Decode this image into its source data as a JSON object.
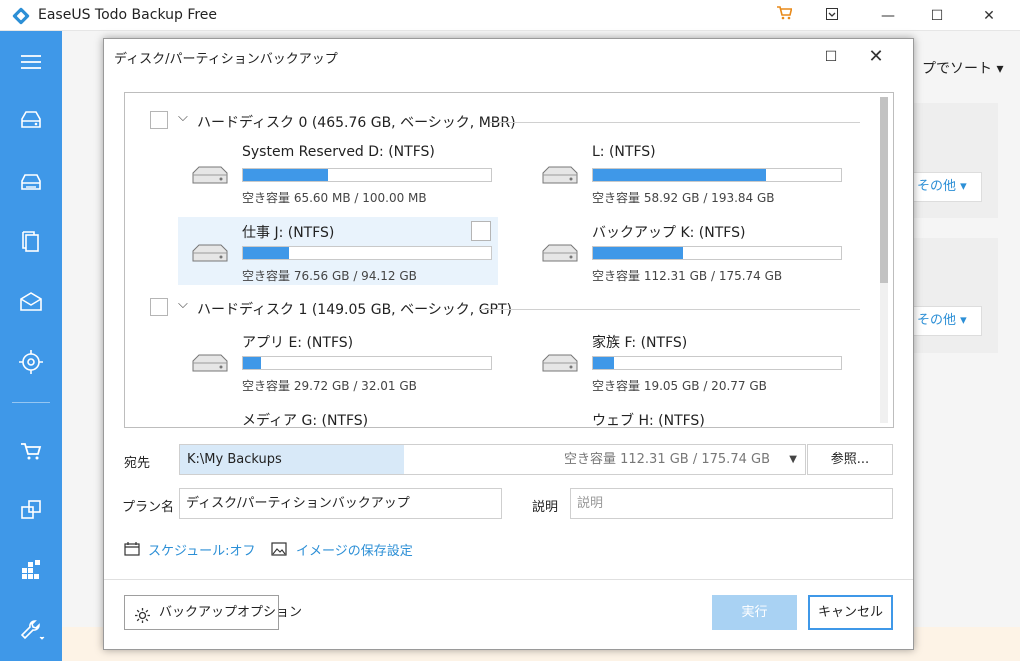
{
  "app": {
    "title": "EaseUS Todo Backup Free"
  },
  "titlebar": {
    "cart_icon": "cart-icon",
    "menu_icon": "dropdown-box-icon",
    "minimize": "—",
    "maximize": "☐",
    "close": "✕"
  },
  "sidebar": {
    "icons": [
      "menu-icon",
      "disk-backup-icon",
      "system-backup-icon",
      "file-backup-icon",
      "mail-backup-icon",
      "smart-backup-icon",
      "cart-icon",
      "clone-icon",
      "tools-grid-icon",
      "wrench-icon"
    ]
  },
  "background": {
    "sort_label": "プでソート",
    "other_label": "その他"
  },
  "dialog": {
    "title": "ディスク/パーティションバックアップ",
    "maximize": "☐",
    "close": "✕",
    "disks": [
      {
        "label": "ハードディスク 0 (465.76 GB, ベーシック, MBR)",
        "partitions": [
          {
            "name": "System Reserved D: (NTFS)",
            "capacity": "空き容量 65.60 MB / 100.00 MB",
            "used_fraction": 0.344
          },
          {
            "name": "L: (NTFS)",
            "capacity": "空き容量 58.92 GB / 193.84 GB",
            "used_fraction": 0.696
          },
          {
            "name": "仕事 J: (NTFS)",
            "capacity": "空き容量 76.56 GB / 94.12 GB",
            "used_fraction": 0.187
          },
          {
            "name": "バックアップ K: (NTFS)",
            "capacity": "空き容量 112.31 GB / 175.74 GB",
            "used_fraction": 0.361
          }
        ]
      },
      {
        "label": "ハードディスク 1 (149.05 GB, ベーシック, GPT)",
        "partitions": [
          {
            "name": "アプリ E: (NTFS)",
            "capacity": "空き容量 29.72 GB / 32.01 GB",
            "used_fraction": 0.072
          },
          {
            "name": "家族 F: (NTFS)",
            "capacity": "空き容量 19.05 GB / 20.77 GB",
            "used_fraction": 0.083
          },
          {
            "name": "メディア G: (NTFS)"
          },
          {
            "name": "ウェブ H: (NTFS)"
          }
        ]
      }
    ],
    "destination": {
      "label": "宛先",
      "path": "K:\\My Backups",
      "free": "空き容量 112.31 GB / 175.74 GB",
      "browse": "参照..."
    },
    "plan": {
      "label": "プラン名",
      "value": "ディスク/パーティションバックアップ"
    },
    "description": {
      "label": "説明",
      "placeholder": "説明"
    },
    "schedule_link": "スケジュール:オフ",
    "image_settings_link": "イメージの保存設定",
    "options_button": "バックアップオプション",
    "run_button": "実行",
    "cancel_button": "キャンセル"
  },
  "colors": {
    "accent": "#3f98e8",
    "link": "#2c8fd6",
    "run_disabled": "#a9d2f3",
    "selected_row": "#e9f3fc",
    "destination_highlight": "#d8e9f8"
  }
}
